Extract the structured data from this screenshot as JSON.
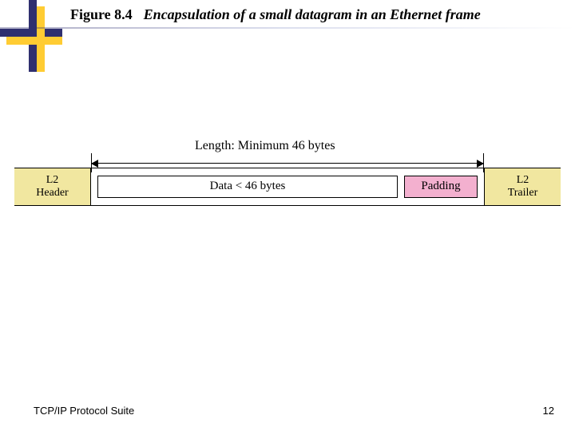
{
  "header": {
    "figure_label": "Figure 8.4",
    "figure_caption": "Encapsulation of a small datagram in an Ethernet frame"
  },
  "diagram": {
    "length_label": "Length: Minimum 46 bytes",
    "l2_header": "L2\nHeader",
    "data_label": "Data < 46 bytes",
    "padding_label": "Padding",
    "l2_trailer": "L2\nTrailer"
  },
  "footer": {
    "book": "TCP/IP Protocol Suite",
    "page": "12"
  },
  "colors": {
    "accent_blue": "#2f2f6f",
    "accent_yellow": "#ffcc33",
    "field_fill": "#f1e7a0",
    "padding_fill": "#f3b0cf"
  }
}
